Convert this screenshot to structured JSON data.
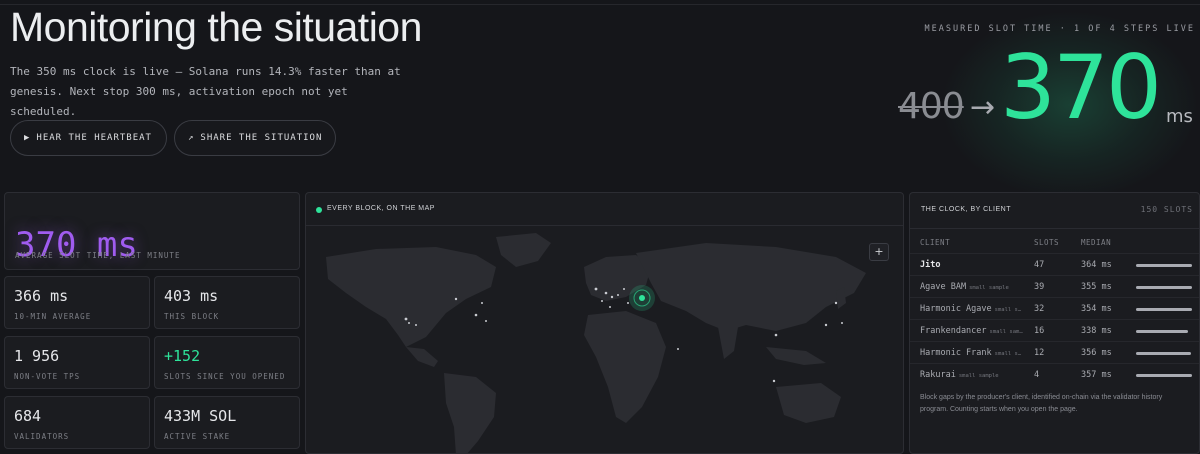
{
  "header": {
    "title": "Monitoring the situation",
    "subtitle": "The 350 ms clock is live — Solana runs 14.3% faster than at genesis. Next stop 300 ms, activation epoch not yet scheduled."
  },
  "buttons": {
    "heartbeat": {
      "icon": "▶",
      "label": "HEAR THE HEARTBEAT"
    },
    "share": {
      "icon": "↗",
      "label": "SHARE THE SITUATION"
    }
  },
  "slot_time": {
    "caption": "MEASURED SLOT TIME · 1 OF 4 STEPS LIVE",
    "old_value": "400",
    "arrow": "→",
    "new_value": "370",
    "unit": "ms"
  },
  "stats": {
    "average": {
      "value": "370 ms",
      "label": "AVERAGE SLOT TIME, LAST MINUTE"
    },
    "ten_min": {
      "value": "366 ms",
      "label": "10-MIN AVERAGE"
    },
    "this_block": {
      "value": "403 ms",
      "label": "THIS BLOCK"
    },
    "tps": {
      "value": "1 956",
      "label": "NON-VOTE TPS"
    },
    "slots_since": {
      "value": "+152",
      "label": "SLOTS SINCE YOU OPENED"
    },
    "validators": {
      "value": "684",
      "label": "VALIDATORS"
    },
    "stake": {
      "value": "433M SOL",
      "label": "ACTIVE STAKE"
    }
  },
  "map": {
    "title": "EVERY BLOCK, ON THE MAP",
    "zoom_label": "+",
    "land_color": "#303136",
    "accent": "#2ee39a"
  },
  "clients": {
    "title": "THE CLOCK, BY CLIENT",
    "count": "150 SLOTS",
    "columns": {
      "client": "CLIENT",
      "slots": "SLOTS",
      "median": "MEDIAN"
    },
    "rows": [
      {
        "name": "Jito",
        "note": "",
        "slots": "47",
        "median": "364 ms",
        "bar": 1.0
      },
      {
        "name": "Agave BAM",
        "note": "small sample",
        "slots": "39",
        "median": "355 ms",
        "bar": 1.0
      },
      {
        "name": "Harmonic Agave",
        "note": "small s…",
        "slots": "32",
        "median": "354 ms",
        "bar": 1.0
      },
      {
        "name": "Frankendancer",
        "note": "small sam…",
        "slots": "16",
        "median": "338 ms",
        "bar": 0.93
      },
      {
        "name": "Harmonic Frank",
        "note": "small s…",
        "slots": "12",
        "median": "356 ms",
        "bar": 0.98
      },
      {
        "name": "Rakurai",
        "note": "small sample",
        "slots": "4",
        "median": "357 ms",
        "bar": 1.0
      }
    ],
    "note": "Block gaps by the producer's client, identified on-chain via the validator history program. Counting starts when you open the page."
  }
}
